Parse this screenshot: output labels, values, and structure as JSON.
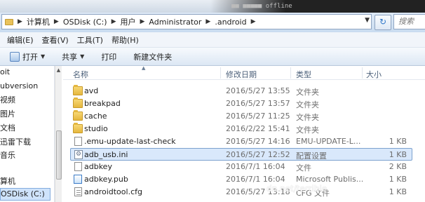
{
  "window": {
    "top_strip_text": "■■ ■■■■■ offline"
  },
  "address_bar": {
    "breadcrumbs": [
      "计算机",
      "OSDisk (C:)",
      "用户",
      "Administrator",
      ".android"
    ],
    "search_placeholder": "搜索 .andr"
  },
  "menu": {
    "items": [
      "编辑(E)",
      "查看(V)",
      "工具(T)",
      "帮助(H)"
    ]
  },
  "command_bar": {
    "open_label": "打开",
    "share_label": "共享",
    "print_label": "打印",
    "new_folder_label": "新建文件夹"
  },
  "nav_pane": {
    "items": [
      {
        "label": "oit"
      },
      {
        "label": "ubversion"
      },
      {
        "label": "视频"
      },
      {
        "label": "图片"
      },
      {
        "label": "文档"
      },
      {
        "label": "迅雷下载"
      },
      {
        "label": "音乐"
      },
      {
        "label": "算机"
      },
      {
        "label": "OSDisk (C:)"
      }
    ]
  },
  "file_list": {
    "columns": {
      "name": "名称",
      "modified": "修改日期",
      "type": "类型",
      "size": "大小"
    },
    "rows": [
      {
        "name": "avd",
        "modified": "2016/5/27 13:55",
        "type": "文件夹",
        "size": "",
        "icon": "folder-icon"
      },
      {
        "name": "breakpad",
        "modified": "2016/5/27 13:57",
        "type": "文件夹",
        "size": "",
        "icon": "folder-icon"
      },
      {
        "name": "cache",
        "modified": "2016/5/27 11:25",
        "type": "文件夹",
        "size": "",
        "icon": "folder-icon"
      },
      {
        "name": "studio",
        "modified": "2016/2/22 15:41",
        "type": "文件夹",
        "size": "",
        "icon": "folder-icon"
      },
      {
        "name": ".emu-update-last-check",
        "modified": "2016/5/27 14:16",
        "type": "EMU-UPDATE-L...",
        "size": "1 KB",
        "icon": "file-icon"
      },
      {
        "name": "adb_usb.ini",
        "modified": "2016/5/27 12:52",
        "type": "配置设置",
        "size": "1 KB",
        "icon": "ini-file-icon",
        "selected": true
      },
      {
        "name": "adbkey",
        "modified": "2016/7/1 16:04",
        "type": "文件",
        "size": "2 KB",
        "icon": "file-icon"
      },
      {
        "name": "adbkey.pub",
        "modified": "2016/7/1 16:04",
        "type": "Microsoft Publis...",
        "size": "1 KB",
        "icon": "publisher-file-icon"
      },
      {
        "name": "androidtool.cfg",
        "modified": "2016/5/27 13:18",
        "type": "CFG 文件",
        "size": "1 KB",
        "icon": "cfg-file-icon"
      }
    ]
  },
  "watermark": "dn.net/terrible"
}
